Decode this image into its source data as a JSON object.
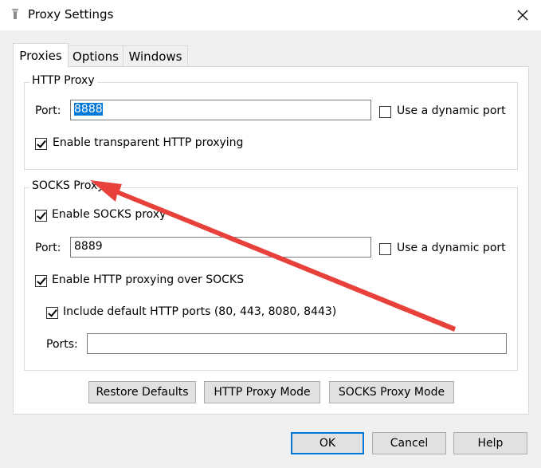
{
  "window": {
    "title": "Proxy Settings"
  },
  "tabs": [
    "Proxies",
    "Options",
    "Windows"
  ],
  "http_proxy": {
    "title": "HTTP Proxy",
    "port_label": "Port:",
    "port_value": "8888",
    "dynamic_port_label": "Use a dynamic port",
    "dynamic_port_checked": false,
    "transparent_label": "Enable transparent HTTP proxying",
    "transparent_checked": true
  },
  "socks_proxy": {
    "title": "SOCKS Proxy",
    "enable_label": "Enable SOCKS proxy",
    "enable_checked": true,
    "port_label": "Port:",
    "port_value": "8889",
    "dynamic_port_label": "Use a dynamic port",
    "dynamic_port_checked": false,
    "http_over_socks_label": "Enable HTTP proxying over SOCKS",
    "http_over_socks_checked": true,
    "include_default_label": "Include default HTTP ports (80, 443, 8080, 8443)",
    "include_default_checked": true,
    "ports_label": "Ports:",
    "ports_value": ""
  },
  "panel_buttons": {
    "restore_defaults": "Restore Defaults",
    "http_proxy_mode": "HTTP Proxy Mode",
    "socks_proxy_mode": "SOCKS Proxy Mode"
  },
  "dialog_buttons": {
    "ok": "OK",
    "cancel": "Cancel",
    "help": "Help"
  },
  "annotation": {
    "arrow_color": "#e8403a"
  }
}
